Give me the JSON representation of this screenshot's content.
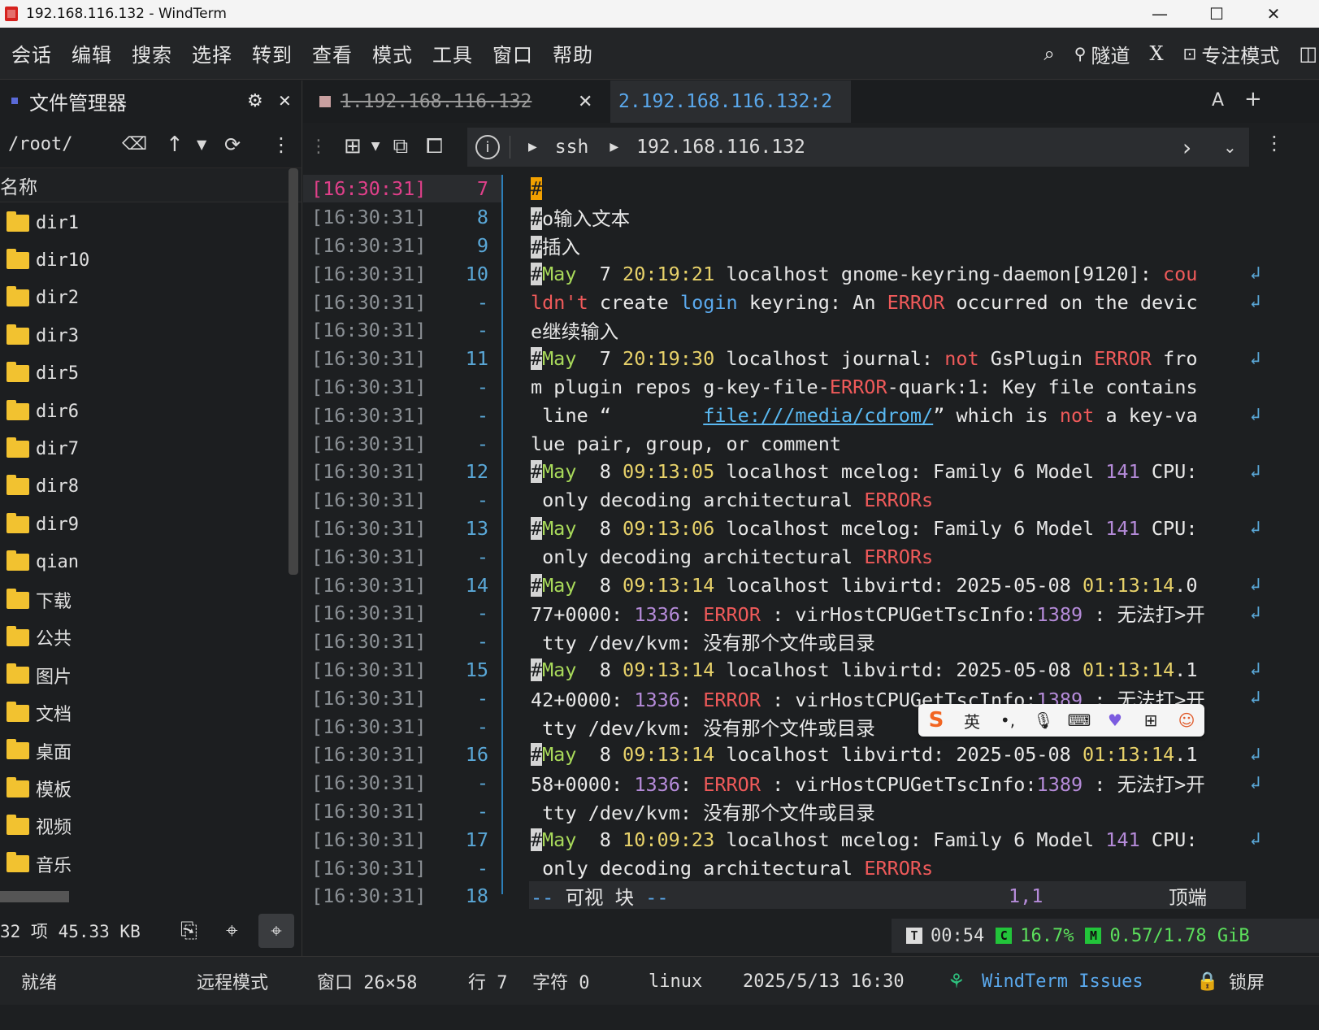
{
  "window": {
    "title": "192.168.116.132 - WindTerm"
  },
  "menu": [
    "会话",
    "编辑",
    "搜索",
    "选择",
    "转到",
    "查看",
    "模式",
    "工具",
    "窗口",
    "帮助"
  ],
  "menu_right": {
    "tunnel": "隧道",
    "x": "X",
    "focus": "专注模式"
  },
  "file_manager": {
    "title": "文件管理器",
    "path": "/root/",
    "column": "名称",
    "items": [
      "dir1",
      "dir10",
      "dir2",
      "dir3",
      "dir5",
      "dir6",
      "dir7",
      "dir8",
      "dir9",
      "qian",
      "下载",
      "公共",
      "图片",
      "文档",
      "桌面",
      "模板",
      "视频",
      "音乐"
    ],
    "status": "32 项 45.33 KB"
  },
  "tabs": [
    {
      "label": "1.192.168.116.132",
      "closed": true
    },
    {
      "label": "2.192.168.116.132:2",
      "active": true
    }
  ],
  "tab_right": {
    "font": "A",
    "add": "+"
  },
  "address": {
    "protocol": "ssh",
    "host": "192.168.116.132"
  },
  "terminal": {
    "timestamp": "[16:30:31]",
    "lines": [
      {
        "n": "7",
        "t": "#"
      },
      {
        "n": "8",
        "t": "#o输入文本"
      },
      {
        "n": "9",
        "t": "#插入"
      },
      {
        "n": "10",
        "t": "#May  7 20:19:21 localhost gnome-keyring-daemon[9120]: cou"
      },
      {
        "n": "-",
        "t": "ldn't create login keyring: An ERROR occurred on the devic"
      },
      {
        "n": "-",
        "t": "e继续输入"
      },
      {
        "n": "11",
        "t": "#May  7 20:19:30 localhost journal: not GsPlugin ERROR fro"
      },
      {
        "n": "-",
        "t": "m plugin repos g-key-file-ERROR-quark:1: Key file contains"
      },
      {
        "n": "-",
        "t": " line “        file:///media/cdrom/” which is not a key-va"
      },
      {
        "n": "-",
        "t": "lue pair, group, or comment"
      },
      {
        "n": "12",
        "t": "#May  8 09:13:05 localhost mcelog: Family 6 Model 141 CPU:"
      },
      {
        "n": "-",
        "t": " only decoding architectural ERRORs"
      },
      {
        "n": "13",
        "t": "#May  8 09:13:06 localhost mcelog: Family 6 Model 141 CPU:"
      },
      {
        "n": "-",
        "t": " only decoding architectural ERRORs"
      },
      {
        "n": "14",
        "t": "#May  8 09:13:14 localhost libvirtd: 2025-05-08 01:13:14.0"
      },
      {
        "n": "-",
        "t": "77+0000: 1336: ERROR : virHostCPUGetTscInfo:1389 : 无法打>开"
      },
      {
        "n": "-",
        "t": " tty /dev/kvm: 没有那个文件或目录"
      },
      {
        "n": "15",
        "t": "#May  8 09:13:14 localhost libvirtd: 2025-05-08 01:13:14.1"
      },
      {
        "n": "-",
        "t": "42+0000: 1336: ERROR : virHostCPUGetTscInfo:1389 : 无法打>开"
      },
      {
        "n": "-",
        "t": " tty /dev/kvm: 没有那个文件或目录"
      },
      {
        "n": "16",
        "t": "#May  8 09:13:14 localhost libvirtd: 2025-05-08 01:13:14.1"
      },
      {
        "n": "-",
        "t": "58+0000: 1336: ERROR : virHostCPUGetTscInfo:1389 : 无法打>开"
      },
      {
        "n": "-",
        "t": " tty /dev/kvm: 没有那个文件或目录"
      },
      {
        "n": "17",
        "t": "#May  8 10:09:23 localhost mcelog: Family 6 Model 141 CPU:"
      },
      {
        "n": "-",
        "t": " only decoding architectural ERRORs"
      },
      {
        "n": "18",
        "t": "-- 可视 块 --"
      }
    ],
    "vim_status": {
      "mode": "-- 可视 块 --",
      "pos": "1,1",
      "where": "顶端"
    }
  },
  "ime": {
    "lang": "英"
  },
  "perf": {
    "time": "00:54",
    "cpu": "16.7%",
    "mem": "0.57/1.78 GiB"
  },
  "statusbar": {
    "ready": "就绪",
    "remote": "远程模式",
    "window": "窗口 26×58",
    "row": "行 7",
    "char": "字符 0",
    "os": "linux",
    "datetime": "2025/5/13 16:30",
    "issues": "WindTerm Issues",
    "lock": "锁屏"
  },
  "colors": {
    "accent": "#2d7fb9",
    "error": "#ef5a5a",
    "green": "#a8d95a",
    "purple": "#b58bd9"
  }
}
